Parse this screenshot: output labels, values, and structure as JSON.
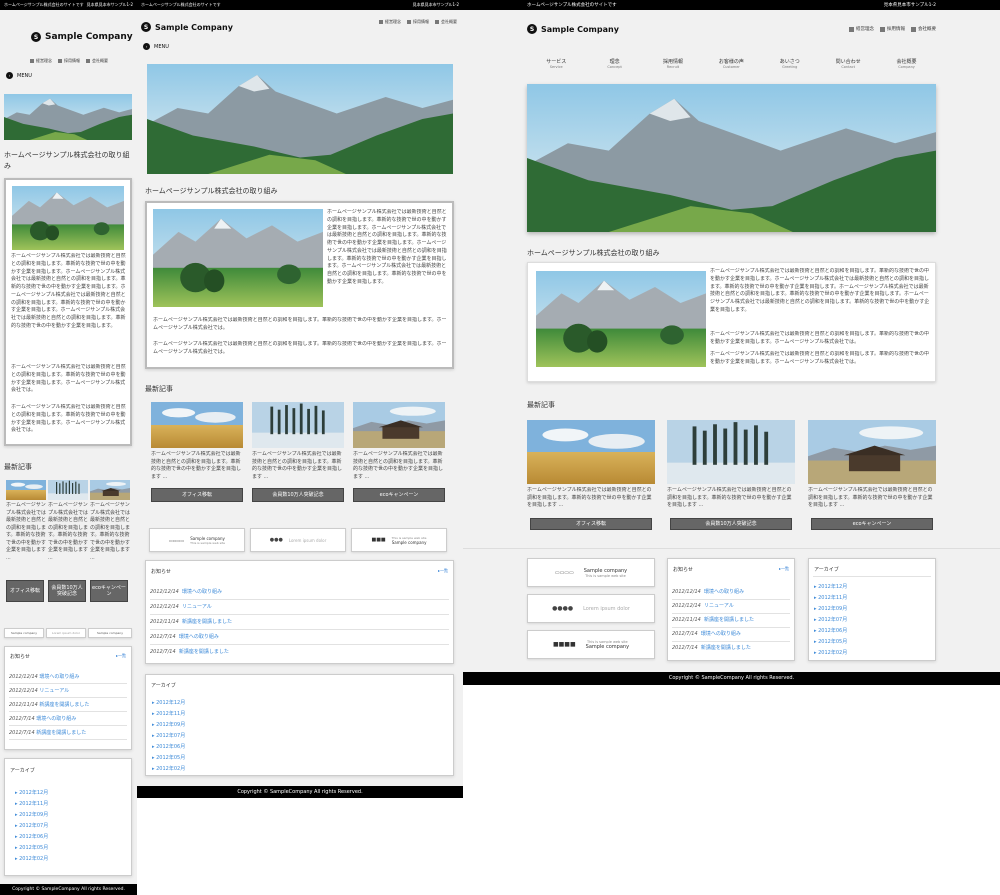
{
  "site": {
    "tagline": "ホームページサンプル株式会社のサイトです",
    "address": "見本県見本市サンプル1-2",
    "logo_mark": "S",
    "company": "Sample Company",
    "menu_label": "MENU",
    "copyright": "Copyright © SampleCompany All rights Reserved."
  },
  "header_links": [
    "経営理念",
    "採用情報",
    "会社概要"
  ],
  "main_nav": [
    {
      "ja": "サービス",
      "en": "Service"
    },
    {
      "ja": "理念",
      "en": "Concept"
    },
    {
      "ja": "採用情報",
      "en": "Recruit"
    },
    {
      "ja": "お客様の声",
      "en": "Customer"
    },
    {
      "ja": "あいさつ",
      "en": "Greeting"
    },
    {
      "ja": "問い合わせ",
      "en": "Contact"
    },
    {
      "ja": "会社概要",
      "en": "Company"
    }
  ],
  "intro": {
    "title": "ホームページサンプル株式会社の取り組み",
    "p1": "ホームページサンプル株式会社では最新技術と自然との調和を目指します。革新的な技術で世の中を動かす企業を目指します。ホームページサンプル株式会社では最新技術と自然との調和を目指します。革新的な技術で世の中を動かす企業を目指します。ホームページサンプル株式会社では最新技術と自然との調和を目指します。革新的な技術で世の中を動かす企業を目指します。ホームページサンプル株式会社では最新技術と自然との調和を目指します。革新的な技術で世の中を動かす企業を目指します。",
    "p2": "ホームページサンプル株式会社では最新技術と自然との調和を目指します。革新的な技術で世の中を動かす企業を目指します。ホームページサンプル株式会社では。",
    "p3": "ホームページサンプル株式会社では最新技術と自然との調和を目指します。革新的な技術で世の中を動かす企業を目指します。ホームページサンプル株式会社では。"
  },
  "latest": {
    "title": "最新記事",
    "excerpt": "ホームページサンプル株式会社では最新技術と自然との調和を目指します。革新的な技術で世の中を動かす企業を目指します ...",
    "buttons": [
      "オフィス移転",
      "会員数10万人突破記念",
      "ecoキャンペーン"
    ]
  },
  "banners": {
    "b1_title": "Sample company",
    "b1_sub": "This is sample web site",
    "b2_text": "Lorem ipsum dolor",
    "b3_sub": "This is sample web site",
    "b3_title": "Sample company"
  },
  "news": {
    "title": "お知らせ",
    "more": "一覧",
    "items": [
      {
        "date": "2012/12/14",
        "text": "環境への取り組み"
      },
      {
        "date": "2012/12/14",
        "text": "リニューアル"
      },
      {
        "date": "2012/11/14",
        "text": "新講座を開講しました"
      },
      {
        "date": "2012/7/14",
        "text": "環境への取り組み"
      },
      {
        "date": "2012/7/14",
        "text": "新講座を開講しました"
      }
    ]
  },
  "archive": {
    "title": "アーカイブ",
    "items": [
      "2012年12月",
      "2012年11月",
      "2012年09月",
      "2012年07月",
      "2012年06月",
      "2012年05月",
      "2012年02月"
    ]
  },
  "colors": {
    "accent": "#3d8ad8",
    "button": "#666666",
    "footer": "#000000"
  }
}
